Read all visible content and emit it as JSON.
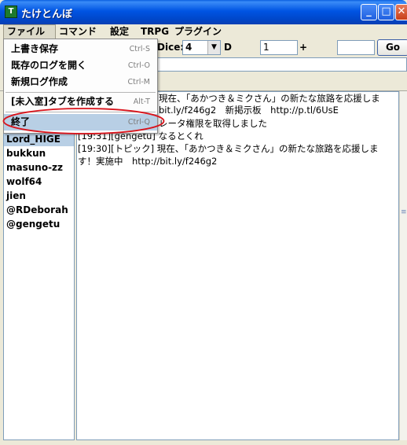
{
  "window": {
    "title": "たけとんぼ",
    "icon_text": "T",
    "buttons": {
      "minimize": "_",
      "maximize": "□",
      "close": "✕"
    }
  },
  "menubar": {
    "items": [
      "ファイル",
      "コマンド",
      "設定",
      "TRPG",
      "プラグイン"
    ]
  },
  "file_menu": {
    "items": [
      {
        "label": "上書き保存",
        "shortcut": "Ctrl-S"
      },
      {
        "label": "既存のログを開く",
        "shortcut": "Ctrl-O"
      },
      {
        "label": "新規ログ作成",
        "shortcut": "Ctrl-M"
      },
      {
        "label": "[未入室]タブを作成する",
        "shortcut": "Alt-T"
      },
      {
        "label": "終了",
        "shortcut": "Ctrl-Q",
        "highlighted": true
      }
    ]
  },
  "dice": {
    "label": "Dice:",
    "count": "4",
    "d_label": "D",
    "sides": "1",
    "plus_label": "+",
    "modifier": "",
    "go_label": "Go"
  },
  "users": [
    "Lord_HIGE",
    "bukkun",
    "masuno-zz",
    "wolf64",
    "jien",
    "@RDeborah",
    "@gengetu"
  ],
  "selected_user": "Lord_HIGE",
  "log": {
    "lines": [
      "現在、「あかつき＆ミクさん」の新たな旅路を応援しま",
      "bit.ly/f246g2　新掲示板　http://p.tl/6UsE",
      "レータ権限を取得しました",
      "[19:31][gengetu] なるとくれ",
      "[19:30][トピック] 現在、「あかつき＆ミクさん」の新たな旅路を応援しま",
      "す！実施中　http://bit.ly/f246g2"
    ]
  },
  "colors": {
    "titlebar": "#0054e3",
    "selection": "#b8cfe5",
    "annotation": "#d9141c"
  }
}
